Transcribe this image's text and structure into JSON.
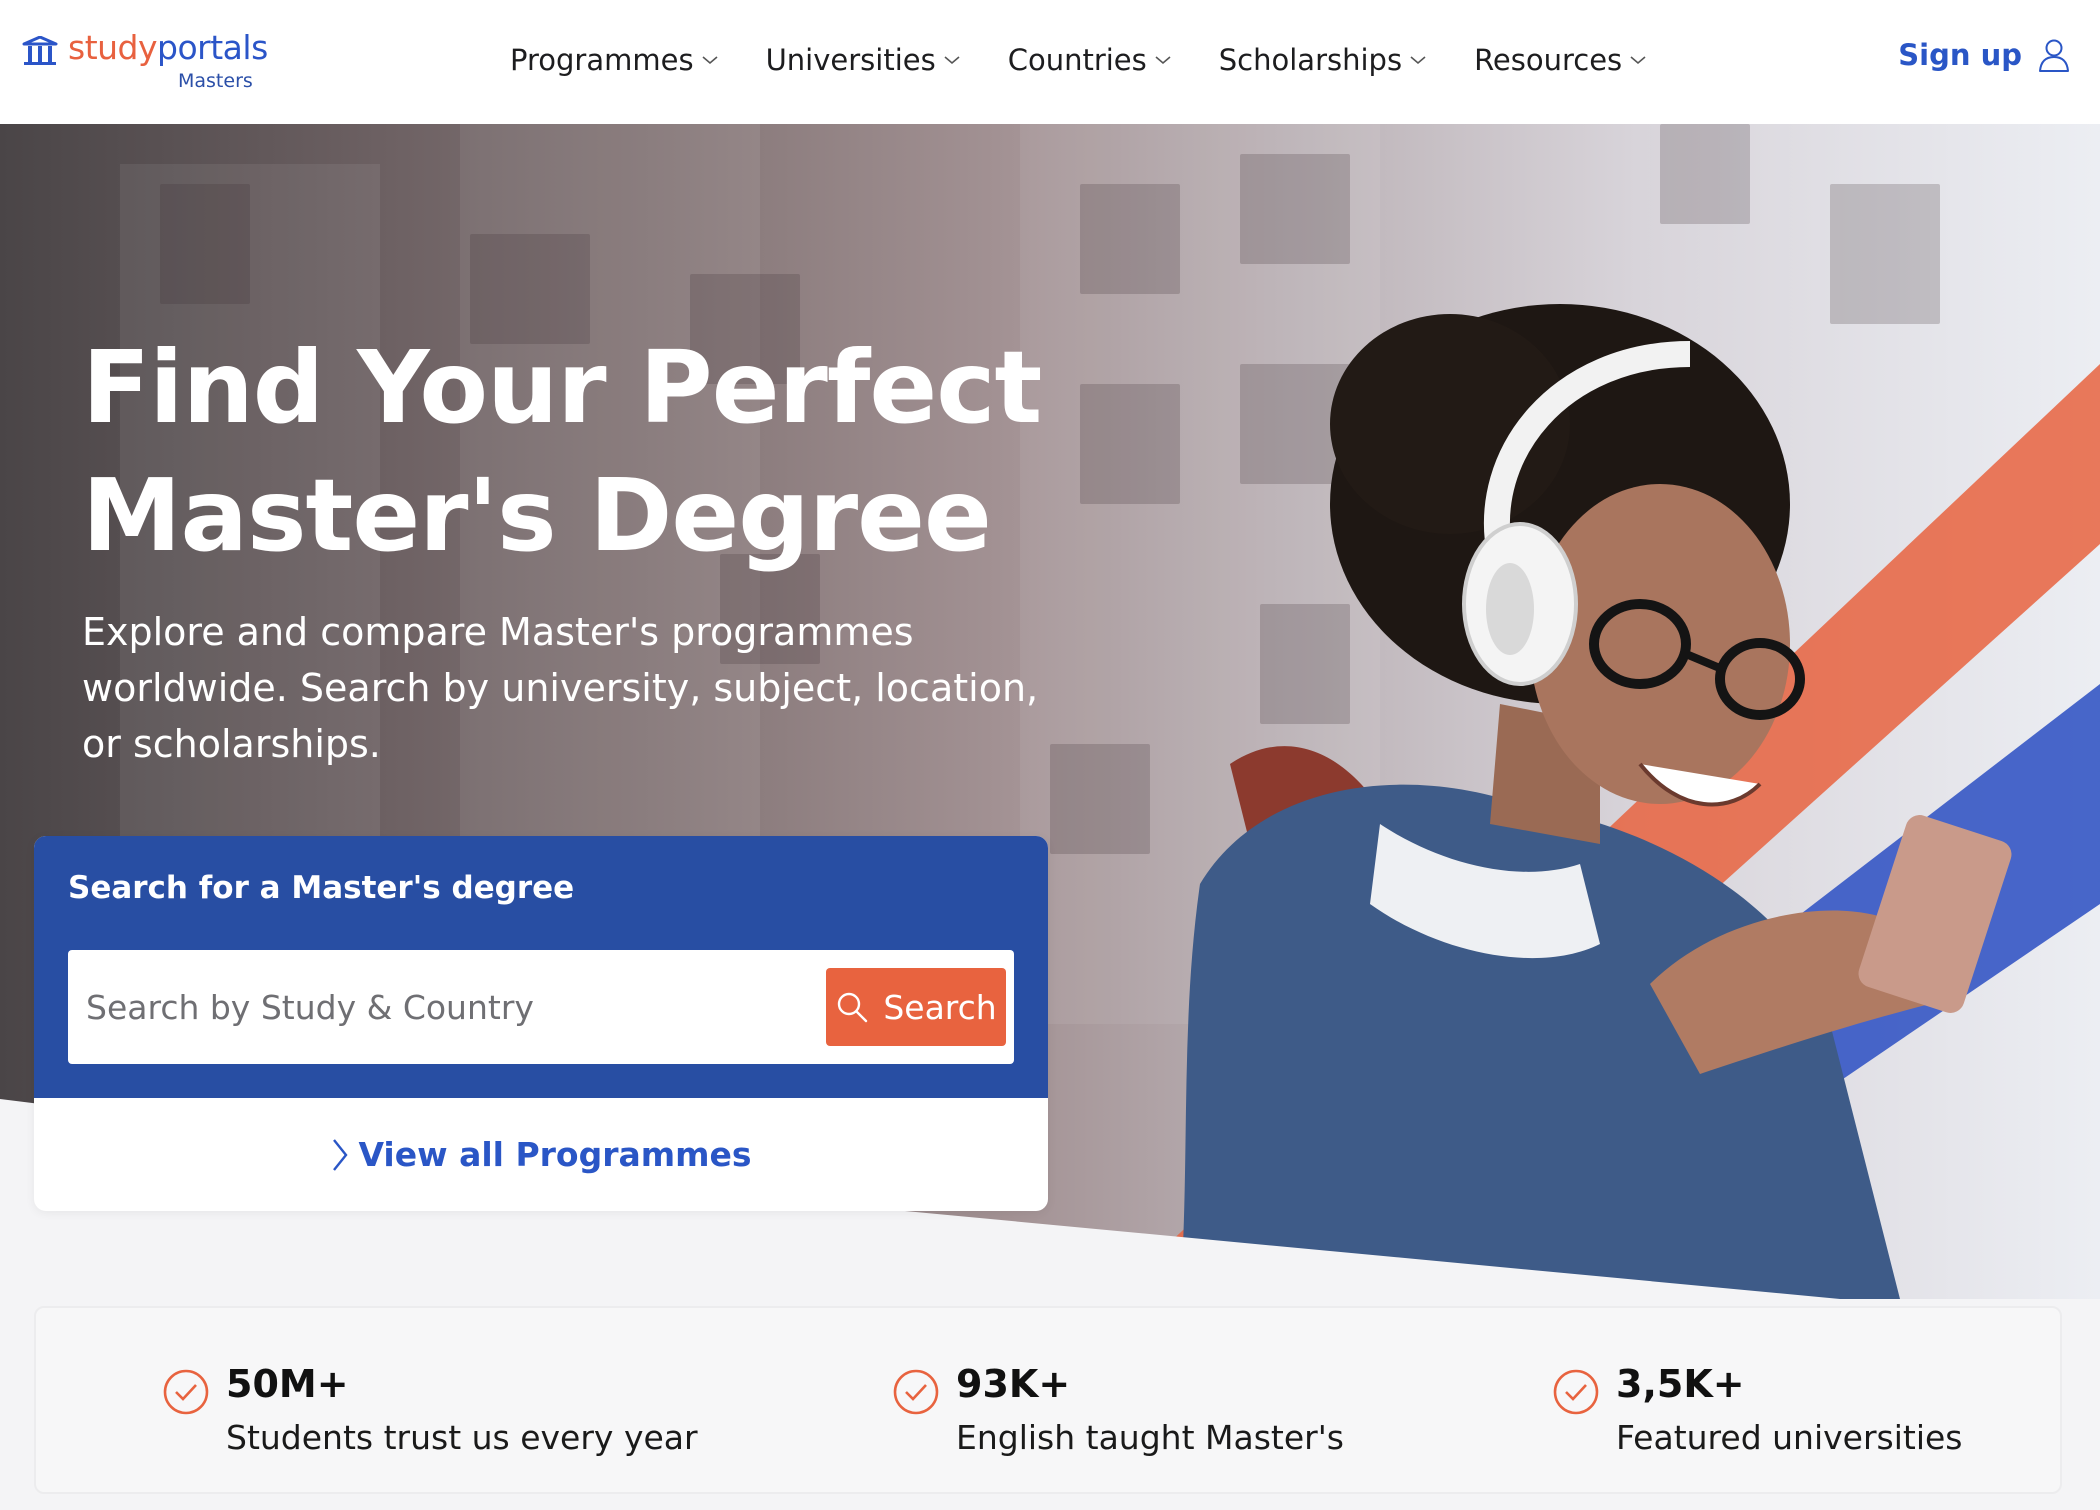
{
  "header": {
    "logo": {
      "study": "study",
      "portals": "portals",
      "sub": "Masters"
    },
    "nav": [
      {
        "label": "Programmes"
      },
      {
        "label": "Universities"
      },
      {
        "label": "Countries"
      },
      {
        "label": "Scholarships"
      },
      {
        "label": "Resources"
      }
    ],
    "signup": "Sign up"
  },
  "hero": {
    "title_line1": "Find Your Perfect",
    "title_line2": "Master's Degree",
    "subtitle": "Explore and compare Master's programmes worldwide. Search by university, subject, location, or scholarships."
  },
  "search": {
    "heading": "Search for a Master's degree",
    "placeholder": "Search by Study & Country",
    "button": "Search",
    "view_all": "View all Programmes"
  },
  "stats": [
    {
      "value": "50M+",
      "label": "Students trust us every year"
    },
    {
      "value": "93K+",
      "label": "English taught Master's"
    },
    {
      "value": "3,5K+",
      "label": "Featured universities"
    }
  ],
  "colors": {
    "brand_blue": "#284ea3",
    "link_blue": "#2a56c6",
    "accent_orange": "#e8633f"
  }
}
